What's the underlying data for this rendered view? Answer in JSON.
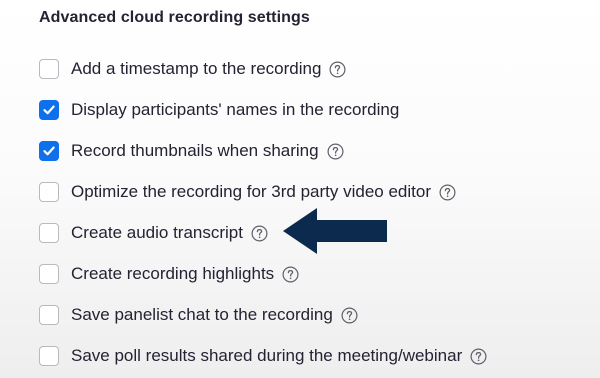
{
  "section": {
    "title": "Advanced cloud recording settings"
  },
  "options": [
    {
      "label": "Add a timestamp to the recording",
      "checked": false
    },
    {
      "label": "Display participants' names in the recording",
      "checked": true
    },
    {
      "label": "Record thumbnails when sharing",
      "checked": true
    },
    {
      "label": "Optimize the recording for 3rd party video editor",
      "checked": false
    },
    {
      "label": "Create audio transcript",
      "checked": false
    },
    {
      "label": "Create recording highlights",
      "checked": false
    },
    {
      "label": "Save panelist chat to the recording",
      "checked": false
    },
    {
      "label": "Save poll results shared during the meeting/webinar",
      "checked": false
    }
  ],
  "icons": {
    "help": "help-icon",
    "check": "checkmark-icon",
    "annotation_arrow": "arrow-left-icon"
  },
  "colors": {
    "accent": "#0e71eb",
    "arrow": "#0b2a4d",
    "text": "#232333"
  }
}
